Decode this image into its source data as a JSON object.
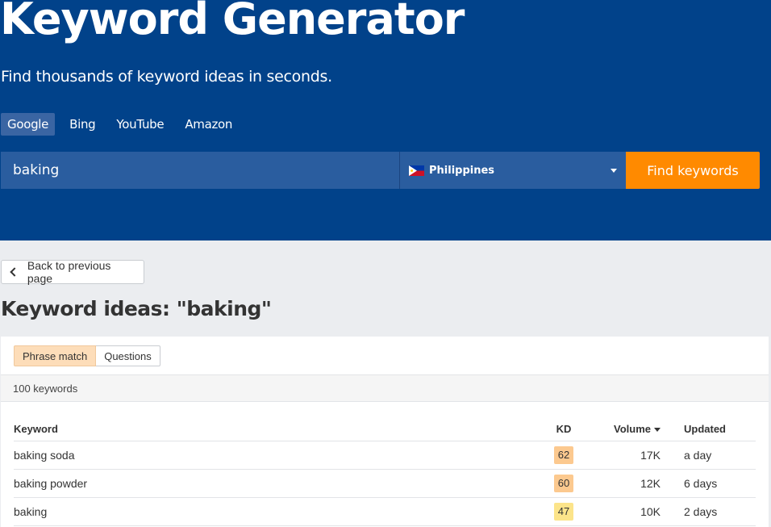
{
  "hero": {
    "title": "Keyword Generator",
    "subtitle": "Find thousands of keyword ideas in seconds."
  },
  "engines": [
    "Google",
    "Bing",
    "YouTube",
    "Amazon"
  ],
  "engine_active": "Google",
  "search": {
    "value": "baking",
    "country": "Philippines",
    "button": "Find keywords"
  },
  "back_label": "Back to previous page",
  "results_title": "Keyword ideas: \"baking\"",
  "match_tabs": [
    "Phrase match",
    "Questions"
  ],
  "match_active": "Phrase match",
  "keyword_count": "100 keywords",
  "table": {
    "headers": {
      "keyword": "Keyword",
      "kd": "KD",
      "volume": "Volume",
      "updated": "Updated"
    },
    "rows": [
      {
        "keyword": "baking soda",
        "kd": "62",
        "volume": "17K",
        "updated": "a day",
        "kd_color": "#fcc98f"
      },
      {
        "keyword": "baking powder",
        "kd": "60",
        "volume": "12K",
        "updated": "6 days",
        "kd_color": "#fcc98f"
      },
      {
        "keyword": "baking",
        "kd": "47",
        "volume": "10K",
        "updated": "2 days",
        "kd_color": "#fce48a"
      }
    ]
  },
  "colors": {
    "hero_bg": "#01428a",
    "accent": "#ff8a00",
    "input_bg": "#2a5d9f"
  }
}
